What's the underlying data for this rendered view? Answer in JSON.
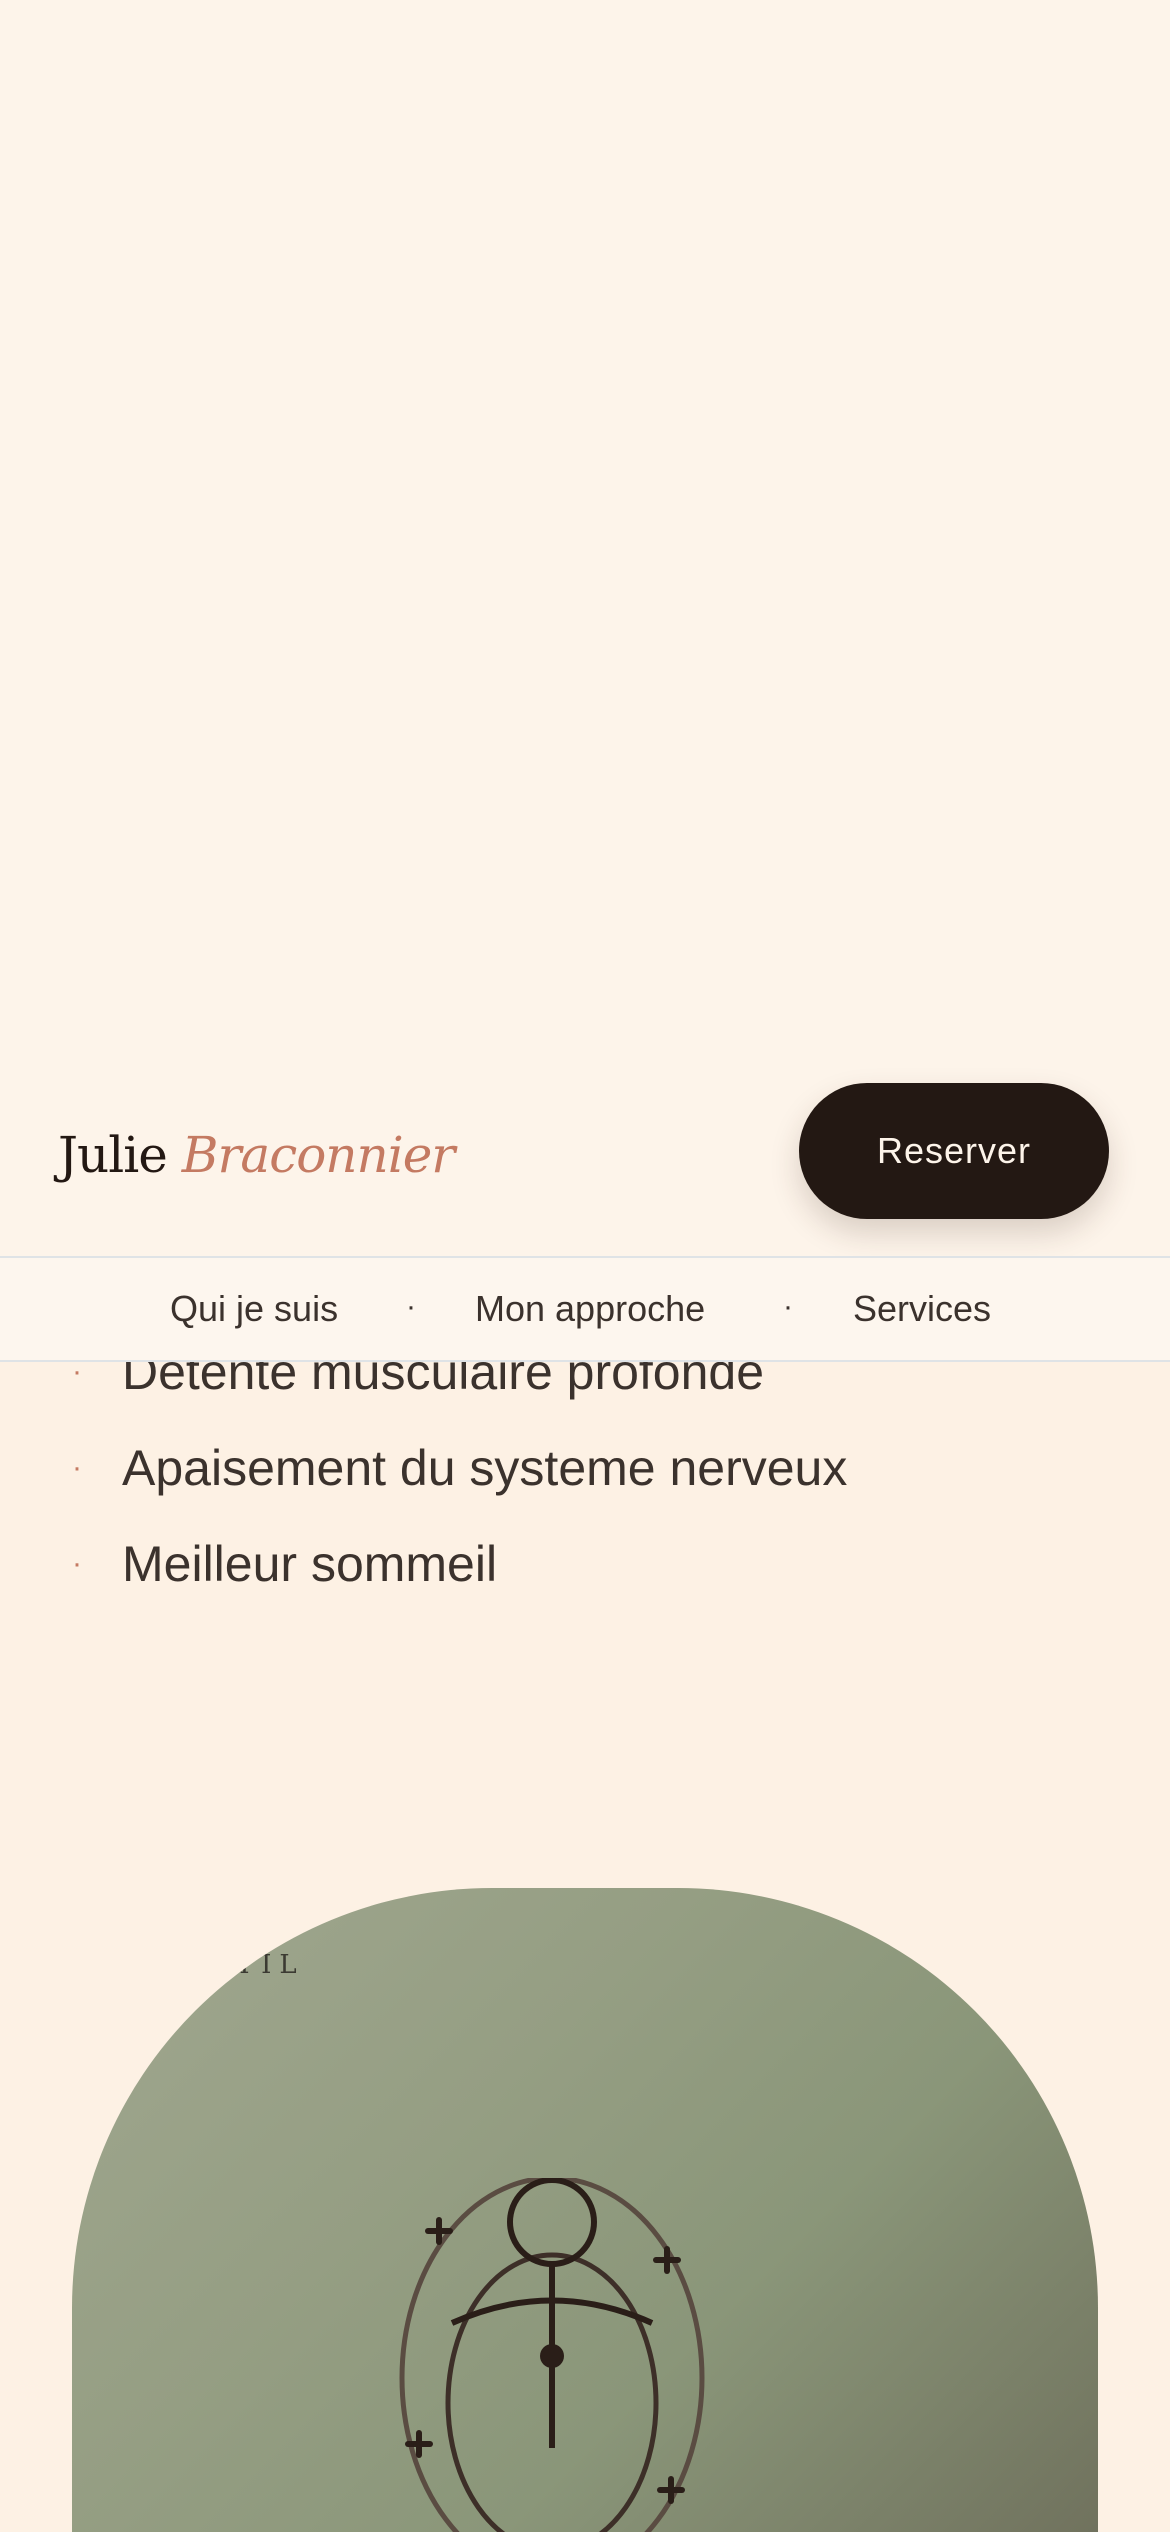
{
  "header": {
    "brand_first": "Julie",
    "brand_last": "Braconnier",
    "reserve_label": "Reserver"
  },
  "nav": {
    "items": [
      "Qui je suis",
      "Mon approche",
      "Services"
    ],
    "separator": "·"
  },
  "benefits": {
    "bullet": "·",
    "items": [
      "Detente musculaire profonde",
      "Apaisement du systeme nerveux",
      "Meilleur sommeil"
    ]
  },
  "card": {
    "eyebrow": "STIL",
    "illustration_icon": "body-energy-figure-icon"
  },
  "colors": {
    "background": "#fdf3e7",
    "accent": "#c47a62",
    "dark": "#231813",
    "card_green": "#959e83"
  }
}
